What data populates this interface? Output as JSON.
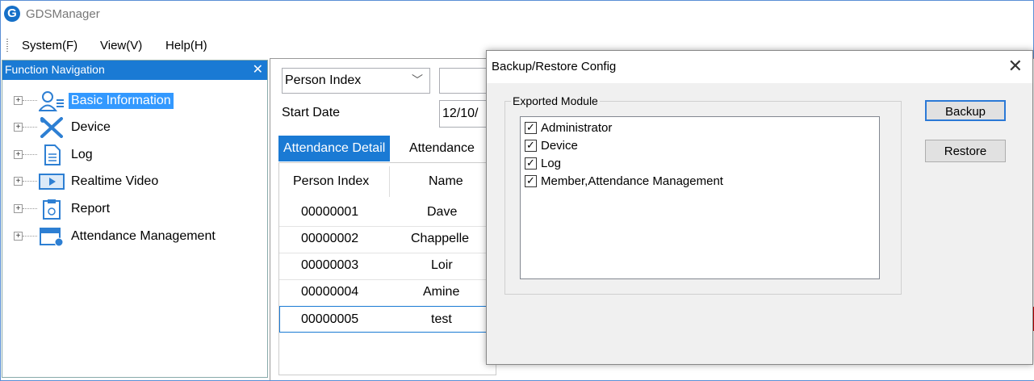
{
  "app": {
    "title": "GDSManager",
    "logo_letter": "G"
  },
  "menu": {
    "items": [
      "System(F)",
      "View(V)",
      "Help(H)"
    ]
  },
  "nav": {
    "title": "Function Navigation",
    "close_glyph": "✕",
    "items": [
      {
        "label": "Basic Information",
        "icon": "person-card-icon",
        "selected": true
      },
      {
        "label": "Device",
        "icon": "tools-icon",
        "selected": false
      },
      {
        "label": "Log",
        "icon": "document-icon",
        "selected": false
      },
      {
        "label": "Realtime Video",
        "icon": "play-icon",
        "selected": false
      },
      {
        "label": "Report",
        "icon": "clipboard-icon",
        "selected": false
      },
      {
        "label": "Attendance Management",
        "icon": "calendar-clock-icon",
        "selected": false
      }
    ]
  },
  "filters": {
    "person_select": "Person Index",
    "start_date_label": "Start Date",
    "start_date_value": "12/10/"
  },
  "tabs": [
    "Attendance Detail",
    "Attendance"
  ],
  "grid": {
    "columns": [
      "Person Index",
      "Name"
    ],
    "rows": [
      [
        "00000001",
        "Dave"
      ],
      [
        "00000002",
        "Chappelle"
      ],
      [
        "00000003",
        "Loir"
      ],
      [
        "00000004",
        "Amine"
      ],
      [
        "00000005",
        "test"
      ]
    ]
  },
  "dialog": {
    "title": "Backup/Restore Config",
    "close_glyph": "✕",
    "group_label": "Exported Module",
    "modules": [
      {
        "label": "Administrator",
        "checked": true
      },
      {
        "label": "Device",
        "checked": true
      },
      {
        "label": "Log",
        "checked": true
      },
      {
        "label": "Member,Attendance Management",
        "checked": true
      }
    ],
    "backup_label": "Backup",
    "restore_label": "Restore"
  },
  "colors": {
    "accent": "#1a7ad4",
    "selection": "#3399ff"
  }
}
